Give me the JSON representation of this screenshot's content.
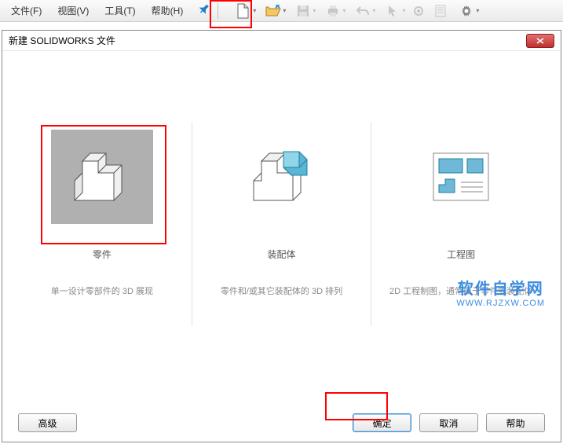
{
  "menubar": {
    "file": "文件(F)",
    "view": "视图(V)",
    "tools": "工具(T)",
    "help": "帮助(H)"
  },
  "dialog": {
    "title": "新建 SOLIDWORKS 文件",
    "options": {
      "part": {
        "label": "零件",
        "desc": "单一设计零部件的 3D 展现"
      },
      "assembly": {
        "label": "装配体",
        "desc": "零件和/或其它装配体的 3D 排列"
      },
      "drawing": {
        "label": "工程图",
        "desc": "2D 工程制图，通常属于零件或装配体"
      }
    },
    "buttons": {
      "advanced": "高级",
      "ok": "确定",
      "cancel": "取消",
      "help": "帮助"
    }
  },
  "watermark": {
    "text": "软件自学网",
    "url": "WWW.RJZXW.COM"
  }
}
